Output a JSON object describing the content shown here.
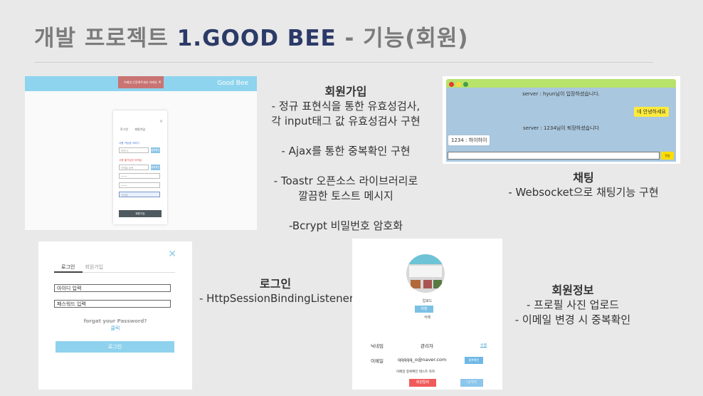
{
  "slide": {
    "title_ko": "개발 프로젝트 ",
    "title_en": "1.GOOD BEE",
    "title_rest": " - 기능(회원)"
  },
  "signup_shot": {
    "brand": "Good Bee",
    "toast": "이메일 인증해주세요 이메일",
    "tabs": [
      "로그인",
      "회원가입"
    ],
    "id_label": "사용 가능한 아이디",
    "id_value": "아이디",
    "check_btn": "중복확인",
    "email_label": "사용 불가능한 이메일",
    "email_value": "이메일 입력",
    "pw1": "••••",
    "pw2": "••••",
    "name": "닉네임",
    "submit": "회원가입"
  },
  "signup_desc": {
    "heading": "회원가입",
    "lines": [
      "- 정규 표현식을 통한 유효성검사,",
      "각 input태그 값 유효성검사 구현",
      "",
      "- Ajax를 통한 중복확인 구현",
      "",
      "- Toastr 오픈소스 라이브러리로",
      "깔끔한 토스트 메시지",
      "",
      "-Bcrypt 비밀번호 암호화"
    ]
  },
  "chat_shot": {
    "sys1": "server : hyun님이 입장하셨습니다.",
    "my_msg": "네 안녕하세요",
    "sys2": "server : 1234님이 퇴장하셨습니다",
    "other_msg": "1234 : 하이하이",
    "send": "전송",
    "colors": {
      "bar": "#b8e36a",
      "body": "#a9c7de",
      "dots": [
        "#e53935",
        "#fdd835",
        "#43a047"
      ]
    }
  },
  "chat_desc": {
    "heading": "채팅",
    "line": "- Websocket으로 채팅기능 구현"
  },
  "login_shot": {
    "tab1": "로그인",
    "tab2": "회원가입",
    "id_placeholder": "아이디 입력",
    "pw_placeholder": "패스워드 입력",
    "forgot": "forgat your Password?",
    "click": "클릭",
    "login_btn": "로그인"
  },
  "login_desc": {
    "heading": "로그인",
    "line": "- HttpSessionBindingListener"
  },
  "profile_shot": {
    "upload": "업로드",
    "save": "저장",
    "delete": "삭제",
    "nick_label": "닉네임",
    "nick_value": "관리자",
    "modify": "수정",
    "email_label": "이메일",
    "email_value": "qqqqq_o@naver.com",
    "dup_check": "중복확인",
    "toast": "이메일 중복확인 테스트 하자",
    "quit": "회원탈퇴",
    "out": "나가기"
  },
  "profile_desc": {
    "heading": "회원정보",
    "lines": [
      "- 프로필 사진 업로드",
      "- 이메일 변경 시 중복확인"
    ]
  }
}
